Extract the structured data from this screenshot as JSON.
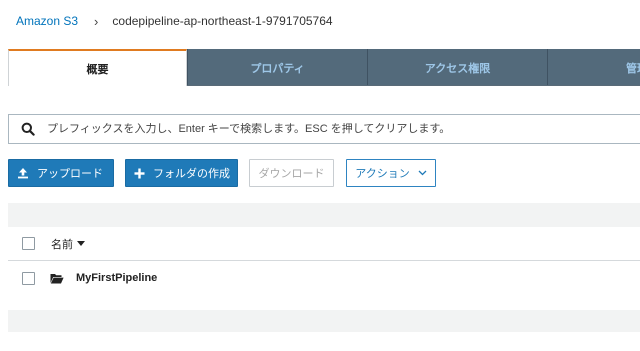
{
  "breadcrumb": {
    "root": "Amazon S3",
    "separator": "›",
    "current": "codepipeline-ap-northeast-1-9791705764"
  },
  "tabs": [
    {
      "label": "概要",
      "active": true
    },
    {
      "label": "プロパティ",
      "active": false
    },
    {
      "label": "アクセス権限",
      "active": false
    },
    {
      "label": "管理",
      "active": false
    }
  ],
  "search": {
    "icon": "search-icon",
    "placeholder": "プレフィックスを入力し、Enter キーで検索します。ESC を押してクリアします。"
  },
  "toolbar": {
    "upload_label": "アップロード",
    "create_folder_label": "フォルダの作成",
    "download_label": "ダウンロード",
    "actions_label": "アクション"
  },
  "table": {
    "columns": [
      "名前"
    ],
    "rows": [
      {
        "type": "folder",
        "name": "MyFirstPipeline"
      }
    ]
  },
  "colors": {
    "link": "#0073bb",
    "tab_active_accent": "#e07b20",
    "tab_inactive_bg": "#536a7b",
    "primary_button": "#1f7ab8"
  }
}
